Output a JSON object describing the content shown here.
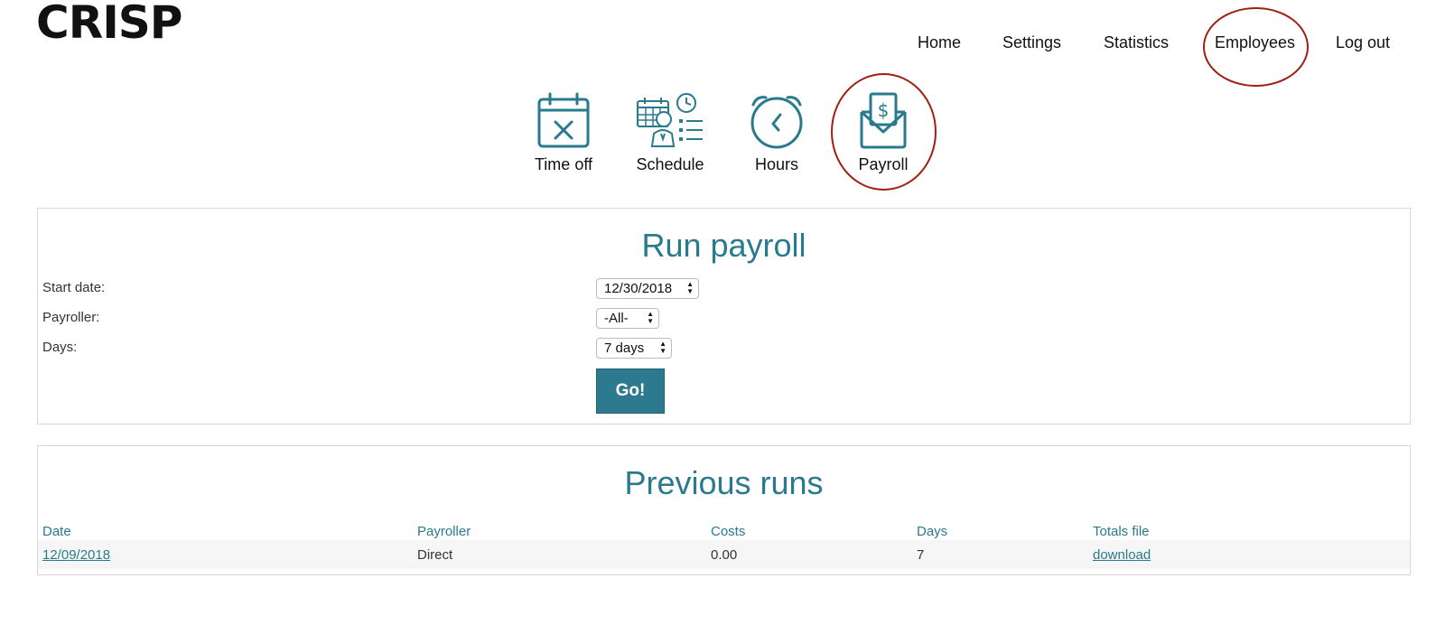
{
  "app": {
    "logo_text": "CRISP",
    "accent_color": "#2a7a8e",
    "highlight_color": "#a01f15"
  },
  "topnav": {
    "items": [
      {
        "label": "Home"
      },
      {
        "label": "Settings"
      },
      {
        "label": "Statistics"
      },
      {
        "label": "Employees",
        "highlighted": true
      },
      {
        "label": "Log out"
      }
    ]
  },
  "subnav": {
    "items": [
      {
        "label": "Time off",
        "icon": "calendar-x-icon"
      },
      {
        "label": "Schedule",
        "icon": "schedule-icon"
      },
      {
        "label": "Hours",
        "icon": "clock-icon"
      },
      {
        "label": "Payroll",
        "icon": "payroll-envelope-icon",
        "highlighted": true
      }
    ]
  },
  "run_payroll": {
    "title": "Run payroll",
    "fields": {
      "start_date": {
        "label": "Start date:",
        "value": "12/30/2018"
      },
      "payroller": {
        "label": "Payroller:",
        "value": "-All-"
      },
      "days": {
        "label": "Days:",
        "value": "7 days"
      }
    },
    "submit_label": "Go!"
  },
  "previous_runs": {
    "title": "Previous runs",
    "columns": [
      "Date",
      "Payroller",
      "Costs",
      "Days",
      "Totals file"
    ],
    "rows": [
      {
        "date": "12/09/2018",
        "payroller": "Direct",
        "costs": "0.00",
        "days": "7",
        "totals_file": "download"
      }
    ]
  }
}
